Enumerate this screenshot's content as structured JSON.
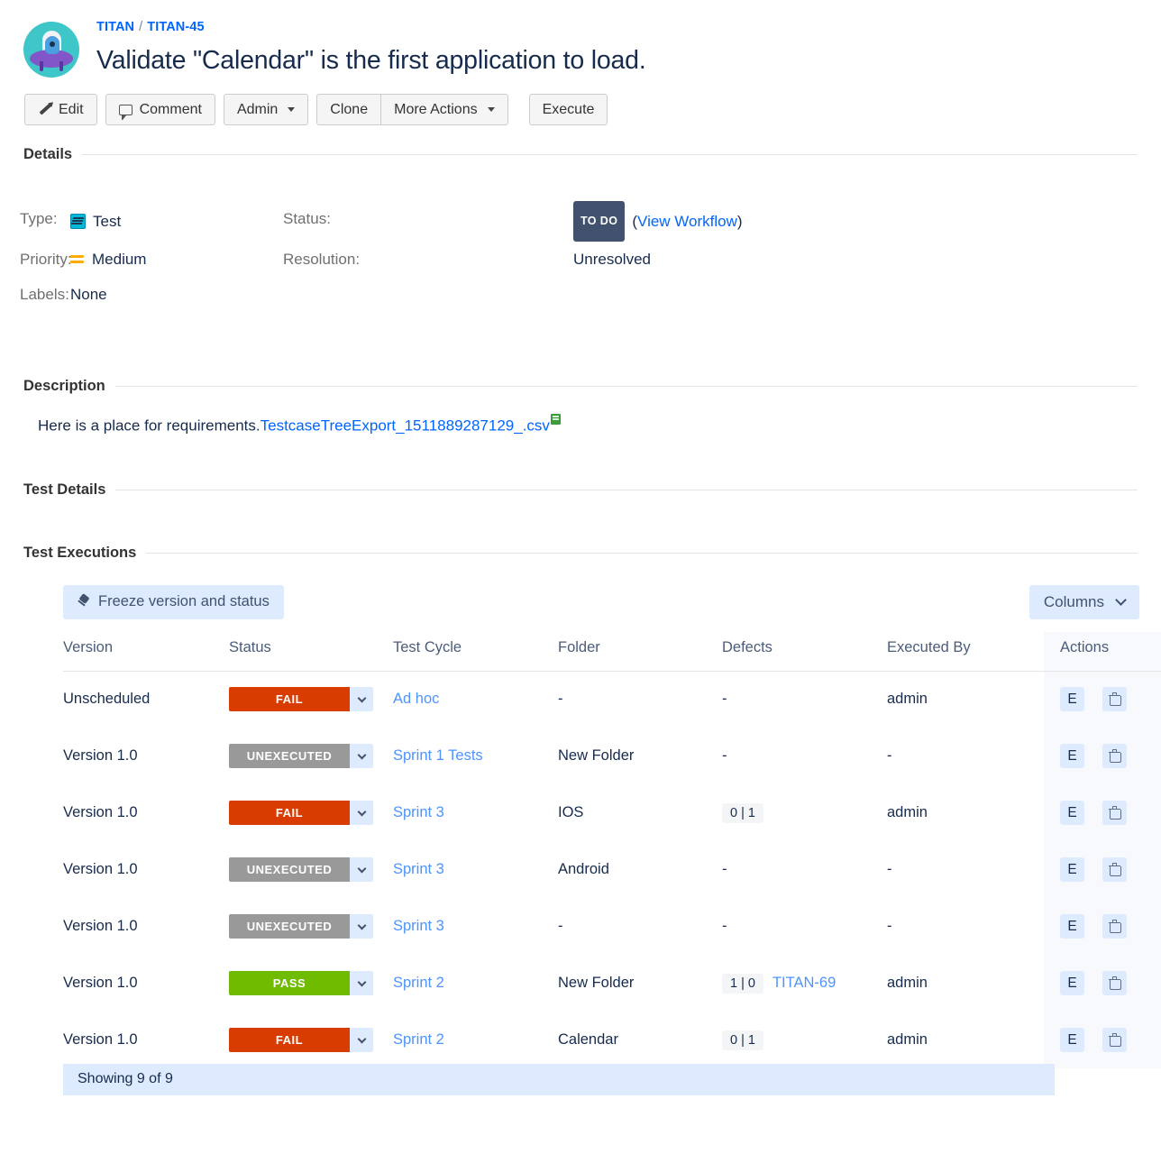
{
  "header": {
    "avatar_icon": "ufo-alien-avatar",
    "breadcrumb_project": "TITAN",
    "breadcrumb_separator": "/",
    "breadcrumb_issue": "TITAN-45",
    "title": "Validate \"Calendar\" is the first application to load."
  },
  "toolbar": {
    "edit_label": "Edit",
    "comment_label": "Comment",
    "admin_label": "Admin",
    "clone_label": "Clone",
    "more_actions_label": "More Actions",
    "execute_label": "Execute"
  },
  "details": {
    "section_title": "Details",
    "type_key": "Type:",
    "type_value": "Test",
    "type_icon": "test-type-icon",
    "priority_key": "Priority:",
    "priority_value": "Medium",
    "priority_icon": "medium-priority-icon",
    "labels_key": "Labels:",
    "labels_value": "None",
    "status_key": "Status:",
    "status_value": "TO DO",
    "view_workflow_open": "(",
    "view_workflow_label": "View Workflow",
    "view_workflow_close": ")",
    "resolution_key": "Resolution:",
    "resolution_value": "Unresolved"
  },
  "description": {
    "section_title": "Description",
    "text": "Here is a place for requirements.",
    "link_label": "TestcaseTreeExport_1511889287129_.csv",
    "attachment_icon": "spreadsheet-attachment-icon"
  },
  "test_details": {
    "section_title": "Test Details"
  },
  "test_executions": {
    "section_title": "Test Executions",
    "freeze_label": "Freeze version and status",
    "freeze_icon": "pin-icon",
    "columns_label": "Columns",
    "columns_icon": "chevron-down-icon",
    "headers": [
      "Version",
      "Status",
      "Test Cycle",
      "Folder",
      "Defects",
      "Executed By",
      "Actions"
    ],
    "rows": [
      {
        "version": "Unscheduled",
        "status": "FAIL",
        "status_kind": "fail",
        "cycle": "Ad hoc",
        "folder": "-",
        "defects": "-",
        "defect_chip": false,
        "defect_link": "",
        "executed_by": "admin",
        "edit_label": "E",
        "delete_icon": "trash-icon"
      },
      {
        "version": "Version 1.0",
        "status": "UNEXECUTED",
        "status_kind": "unexecuted",
        "cycle": "Sprint 1 Tests",
        "folder": "New Folder",
        "defects": "-",
        "defect_chip": false,
        "defect_link": "",
        "executed_by": "-",
        "edit_label": "E",
        "delete_icon": "trash-icon"
      },
      {
        "version": "Version 1.0",
        "status": "FAIL",
        "status_kind": "fail",
        "cycle": "Sprint 3",
        "folder": "IOS",
        "defects": "0 | 1",
        "defect_chip": true,
        "defect_link": "",
        "executed_by": "admin",
        "edit_label": "E",
        "delete_icon": "trash-icon"
      },
      {
        "version": "Version 1.0",
        "status": "UNEXECUTED",
        "status_kind": "unexecuted",
        "cycle": "Sprint 3",
        "folder": "Android",
        "defects": "-",
        "defect_chip": false,
        "defect_link": "",
        "executed_by": "-",
        "edit_label": "E",
        "delete_icon": "trash-icon"
      },
      {
        "version": "Version 1.0",
        "status": "UNEXECUTED",
        "status_kind": "unexecuted",
        "cycle": "Sprint 3",
        "folder": "-",
        "defects": "-",
        "defect_chip": false,
        "defect_link": "",
        "executed_by": "-",
        "edit_label": "E",
        "delete_icon": "trash-icon"
      },
      {
        "version": "Version 1.0",
        "status": "PASS",
        "status_kind": "pass",
        "cycle": "Sprint 2",
        "folder": "New Folder",
        "defects": "1 | 0",
        "defect_chip": true,
        "defect_link": "TITAN-69",
        "executed_by": "admin",
        "edit_label": "E",
        "delete_icon": "trash-icon"
      },
      {
        "version": "Version 1.0",
        "status": "FAIL",
        "status_kind": "fail",
        "cycle": "Sprint 2",
        "folder": "Calendar",
        "defects": "0 | 1",
        "defect_chip": true,
        "defect_link": "",
        "executed_by": "admin",
        "edit_label": "E",
        "delete_icon": "trash-icon"
      }
    ],
    "footer": "Showing 9 of 9"
  },
  "colors": {
    "fail": "#d93c00",
    "pass": "#6fbb00",
    "unexecuted": "#999999",
    "link": "#0065ff",
    "cycle_link": "#4d94ff",
    "accent_bg": "#deebff",
    "status_lozenge": "#42526e"
  }
}
